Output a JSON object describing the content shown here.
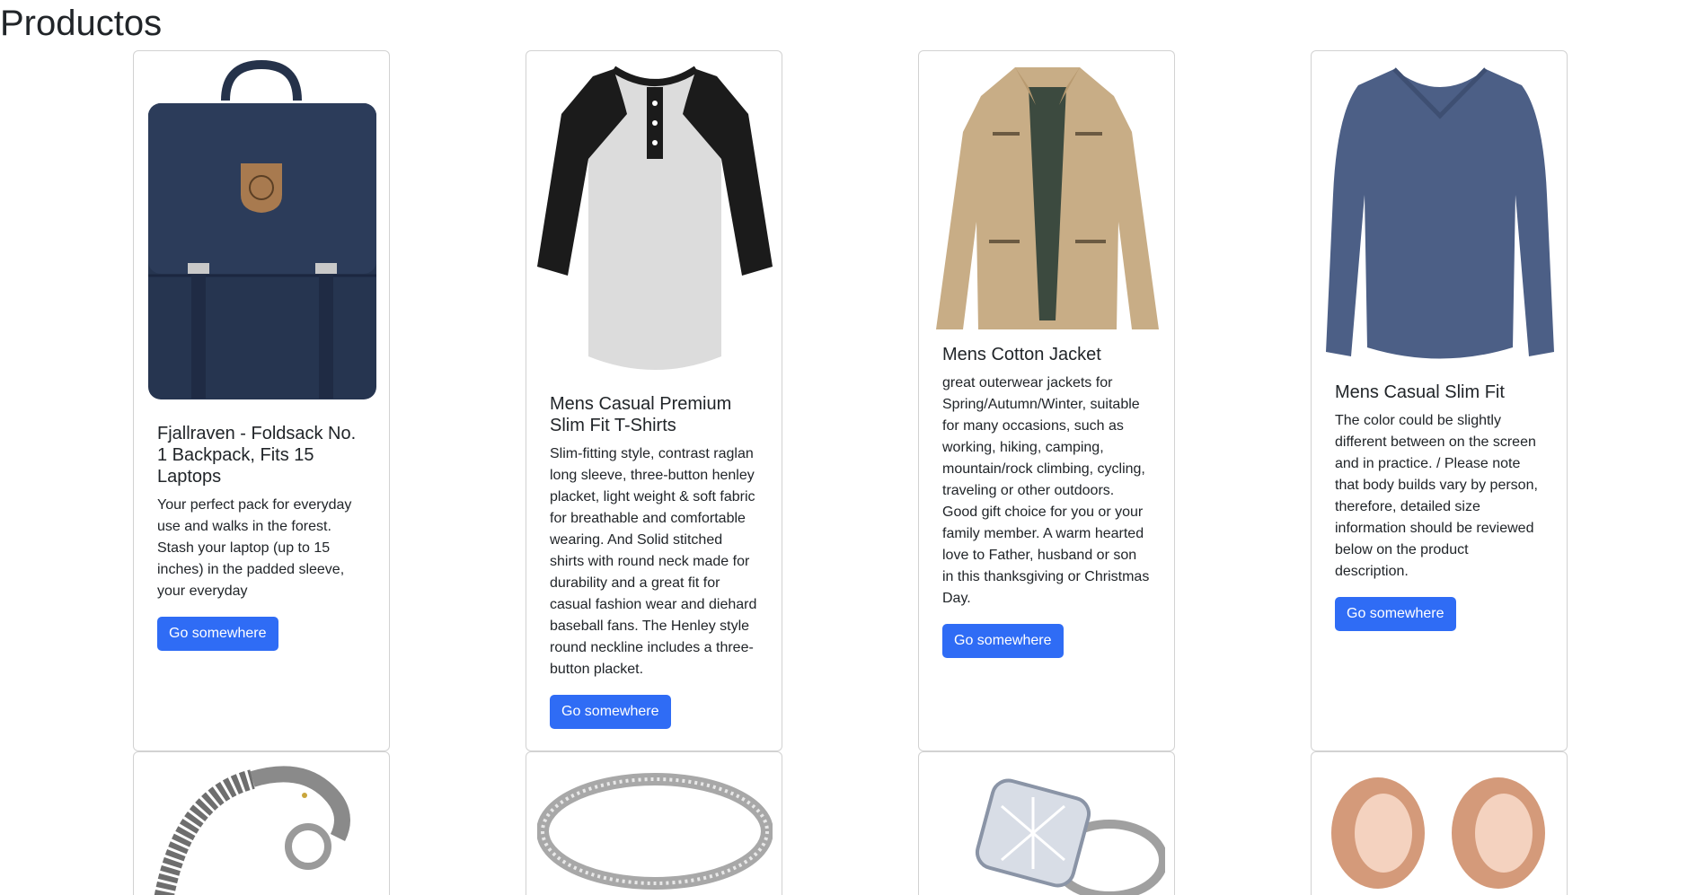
{
  "page": {
    "title": "Productos"
  },
  "button_label": "Go somewhere",
  "colors": {
    "button": "#2f6cf5",
    "text": "#212529",
    "border": "#d9d9d9"
  },
  "products": [
    {
      "title": "Fjallraven - Foldsack No. 1 Backpack, Fits 15 Laptops",
      "description": "Your perfect pack for everyday use and walks in the forest. Stash your laptop (up to 15 inches) in the padded sleeve, your everyday",
      "image": "backpack"
    },
    {
      "title": "Mens Casual Premium Slim Fit T-Shirts",
      "description": "Slim-fitting style, contrast raglan long sleeve, three-button henley placket, light weight & soft fabric for breathable and comfortable wearing. And Solid stitched shirts with round neck made for durability and a great fit for casual fashion wear and diehard baseball fans. The Henley style round neckline includes a three-button placket.",
      "image": "raglan-henley-shirt"
    },
    {
      "title": "Mens Cotton Jacket",
      "description": "great outerwear jackets for Spring/Autumn/Winter, suitable for many occasions, such as working, hiking, camping, mountain/rock climbing, cycling, traveling or other outdoors. Good gift choice for you or your family member. A warm hearted love to Father, husband or son in this thanksgiving or Christmas Day.",
      "image": "cotton-jacket"
    },
    {
      "title": "Mens Casual Slim Fit",
      "description": "The color could be slightly different between on the screen and in practice. / Please note that body builds vary by person, therefore, detailed size information should be reviewed below on the product description.",
      "image": "long-sleeve-shirt"
    },
    {
      "image": "dragon-bracelet"
    },
    {
      "image": "silver-ring"
    },
    {
      "image": "diamond-ring"
    },
    {
      "image": "rose-gold-plugs"
    }
  ]
}
